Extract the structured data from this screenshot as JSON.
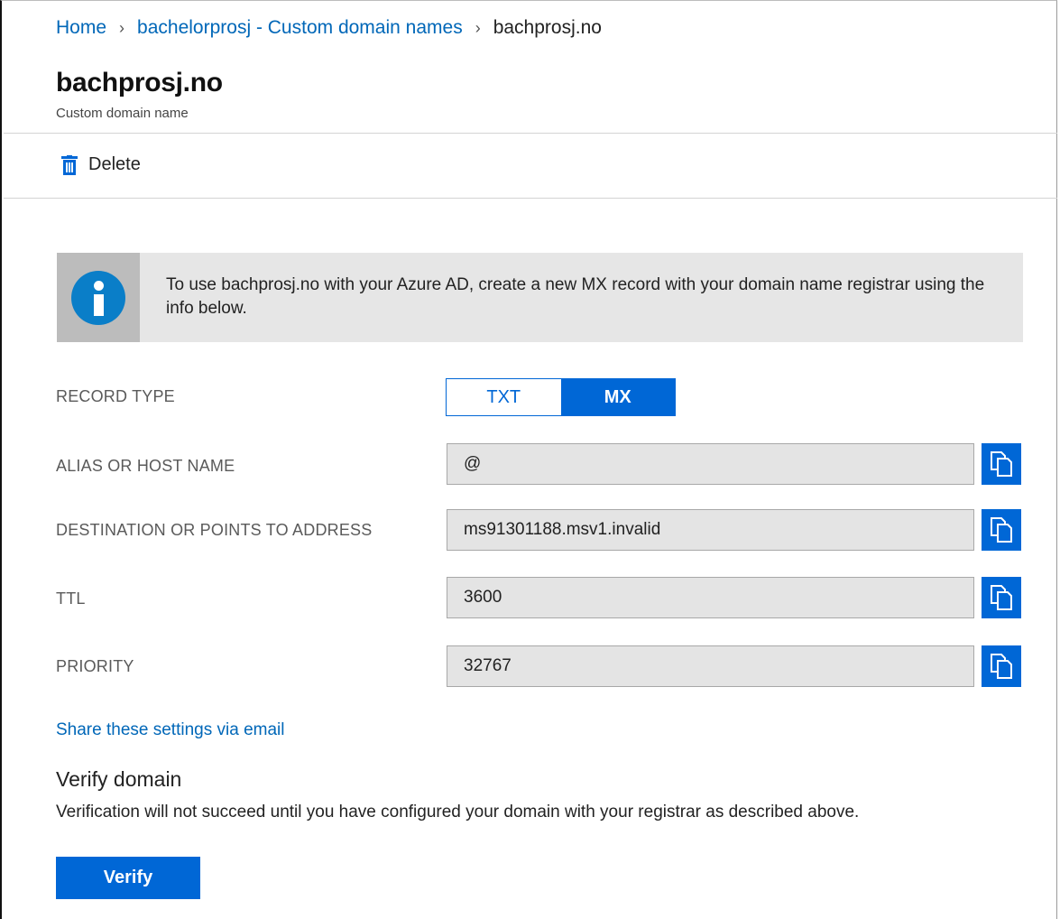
{
  "breadcrumb": {
    "home": "Home",
    "parent": "bachelorprosj - Custom domain names",
    "current": "bachprosj.no",
    "separator": "›"
  },
  "header": {
    "title": "bachprosj.no",
    "subtitle": "Custom domain name"
  },
  "toolbar": {
    "delete_label": "Delete"
  },
  "info": {
    "message": "To use bachprosj.no with your Azure AD, create a new MX record with your domain name registrar using the info below."
  },
  "record_type": {
    "label": "RECORD TYPE",
    "options": [
      "TXT",
      "MX"
    ],
    "selected": "MX"
  },
  "fields": [
    {
      "label": "ALIAS OR HOST NAME",
      "value": "@"
    },
    {
      "label": "DESTINATION OR POINTS TO ADDRESS",
      "value": "ms91301188.msv1.invalid"
    },
    {
      "label": "TTL",
      "value": "3600"
    },
    {
      "label": "PRIORITY",
      "value": "32767"
    }
  ],
  "share_link": "Share these settings via email",
  "verify": {
    "title": "Verify domain",
    "description": "Verification will not succeed until you have configured your domain with your registrar as described above.",
    "button_label": "Verify"
  },
  "colors": {
    "accent": "#0067d6",
    "link": "#0067b8",
    "info_icon": "#0a7ec8"
  },
  "icons": {
    "delete": "trash-icon",
    "info": "info-icon",
    "copy": "copy-icon",
    "breadcrumb_separator": "chevron-right-icon"
  }
}
